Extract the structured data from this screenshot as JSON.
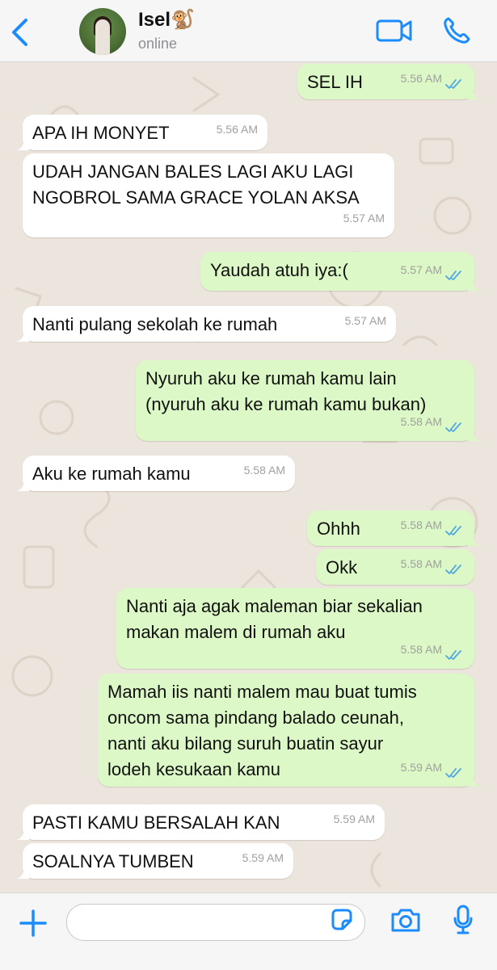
{
  "header": {
    "contact_name": "Isel",
    "contact_emoji": "🐒",
    "status": "online"
  },
  "messages": [
    {
      "dir": "out",
      "text": [
        "SEL IH"
      ],
      "time": "5.56 AM",
      "read": true
    },
    {
      "dir": "in",
      "text": [
        "APA IH MONYET"
      ],
      "time": "5.56 AM"
    },
    {
      "dir": "in",
      "text": [
        "UDAH JANGAN BALES LAGI AKU LAGI",
        "NGOBROL SAMA GRACE YOLAN AKSA"
      ],
      "time": "5.57 AM"
    },
    {
      "dir": "out",
      "text": [
        "Yaudah atuh iya:("
      ],
      "time": "5.57 AM",
      "read": true
    },
    {
      "dir": "in",
      "text": [
        "Nanti pulang sekolah ke rumah"
      ],
      "time": "5.57 AM"
    },
    {
      "dir": "out",
      "text": [
        "Nyuruh aku ke rumah kamu lain",
        "(nyuruh aku ke rumah kamu bukan)"
      ],
      "time": "5.58 AM",
      "read": true
    },
    {
      "dir": "in",
      "text": [
        "Aku ke rumah kamu"
      ],
      "time": "5.58 AM"
    },
    {
      "dir": "out",
      "text": [
        "Ohhh"
      ],
      "time": "5.58 AM",
      "read": true
    },
    {
      "dir": "out",
      "text": [
        "Okk"
      ],
      "time": "5.58 AM",
      "read": true
    },
    {
      "dir": "out",
      "text": [
        "Nanti aja agak maleman biar sekalian",
        "makan malem di rumah aku"
      ],
      "time": "5.58 AM",
      "read": true
    },
    {
      "dir": "out",
      "text": [
        "Mamah iis nanti malem mau buat tumis",
        "oncom sama pindang balado ceunah,",
        "nanti aku bilang suruh buatin sayur",
        "lodeh kesukaan kamu"
      ],
      "time": "5.59 AM",
      "read": true
    },
    {
      "dir": "in",
      "text": [
        "PASTI KAMU BERSALAH KAN"
      ],
      "time": "5.59 AM"
    },
    {
      "dir": "in",
      "text": [
        "SOALNYA TUMBEN"
      ],
      "time": "5.59 AM"
    }
  ],
  "composer": {
    "placeholder": ""
  },
  "icons": {
    "back": "chevron-left-icon",
    "video": "video-camera-icon",
    "call": "phone-icon",
    "plus": "plus-icon",
    "sticker": "sticker-icon",
    "camera": "camera-icon",
    "mic": "microphone-icon"
  },
  "colors": {
    "accent": "#1a8cff",
    "outgoing_bubble": "#dcf8c6",
    "incoming_bubble": "#ffffff",
    "chat_background": "#ece5dd",
    "read_ticks": "#4fa8e0"
  }
}
